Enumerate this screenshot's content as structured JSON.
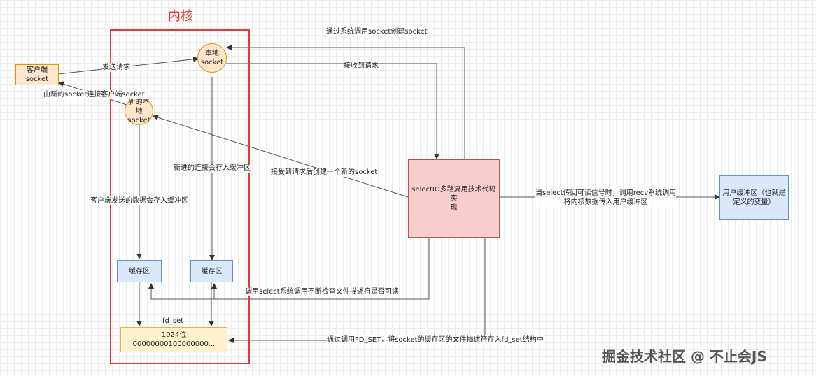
{
  "kernel": {
    "title": "内核"
  },
  "nodes": {
    "client_socket": "客户端socket",
    "local_socket": "本地\nsocket",
    "new_local_socket": "新的本\n地socket",
    "select_impl": "selectIO多路复用技术代码实\n现",
    "user_buffer": "用户缓冲区（也就是\n定义的变量）",
    "buffer_left": "缓存区",
    "buffer_right": "缓存区",
    "fd_set_label": "fd_set",
    "fd_set_box": "1024位\n00000000100000000..."
  },
  "edges": {
    "create_socket": "通过系统调用socket创建socket",
    "send_request": "发送请求",
    "receive_request": "接收到请求",
    "new_socket_connect": "由新的socket连接客户端socket",
    "new_conn_buffer": "新进的连接会存入缓冲区",
    "accept_create": "接受到请求后创建一个新的socket",
    "client_data_buffer": "客户端发送的数据会存入缓冲区",
    "select_readable": "当select传回可读信号时，调用recv系统调用\n将内核数据传入用户缓冲区",
    "select_check": "调用select系统调用不断检查文件描述符是否可读",
    "fd_set_store": "通过调用FD_SET，将socket的缓存区的文件描述符存入fd_set结构中"
  },
  "watermark": "掘金技术社区 @ 不止会JS"
}
